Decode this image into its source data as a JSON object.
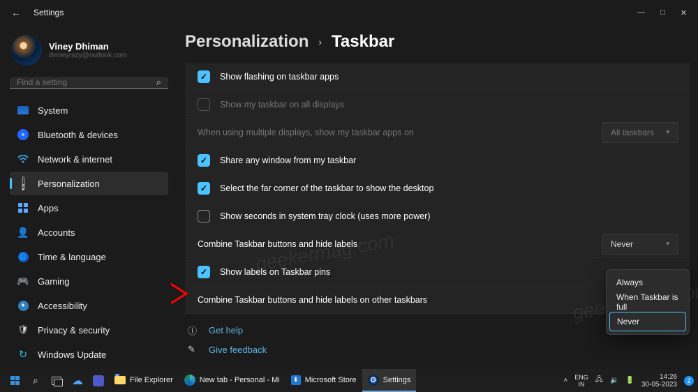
{
  "window": {
    "title": "Settings"
  },
  "profile": {
    "name": "Viney Dhiman",
    "email": "dvineyrazy@outlook.com"
  },
  "search": {
    "placeholder": "Find a setting"
  },
  "nav": {
    "items": [
      {
        "label": "System"
      },
      {
        "label": "Bluetooth & devices"
      },
      {
        "label": "Network & internet"
      },
      {
        "label": "Personalization"
      },
      {
        "label": "Apps"
      },
      {
        "label": "Accounts"
      },
      {
        "label": "Time & language"
      },
      {
        "label": "Gaming"
      },
      {
        "label": "Accessibility"
      },
      {
        "label": "Privacy & security"
      },
      {
        "label": "Windows Update"
      }
    ]
  },
  "breadcrumb": {
    "parent": "Personalization",
    "current": "Taskbar"
  },
  "settings": {
    "flash": "Show flashing on taskbar apps",
    "all_displays": "Show my taskbar on all displays",
    "multi_text": "When using multiple displays, show my taskbar apps on",
    "multi_value": "All taskbars",
    "share": "Share any window from my taskbar",
    "far_corner": "Select the far corner of the taskbar to show the desktop",
    "seconds": "Show seconds in system tray clock (uses more power)",
    "combine1": "Combine Taskbar buttons and hide labels",
    "combine1_value": "Never",
    "labels_pins": "Show labels on Taskbar pins",
    "combine2": "Combine Taskbar buttons and hide labels on other taskbars"
  },
  "dropdown": {
    "opts": [
      "Always",
      "When Taskbar is full",
      "Never"
    ]
  },
  "help": {
    "get_help": "Get help",
    "feedback": "Give feedback"
  },
  "taskbar": {
    "apps": {
      "explorer": "File Explorer",
      "edge": "New tab - Personal - Mi",
      "store": "Microsoft Store",
      "settings": "Settings"
    },
    "tray": {
      "lang1": "ENG",
      "lang2": "IN",
      "time": "14:26",
      "date": "30-05-2023",
      "badge": "2"
    }
  },
  "watermark": "geekermag.com"
}
